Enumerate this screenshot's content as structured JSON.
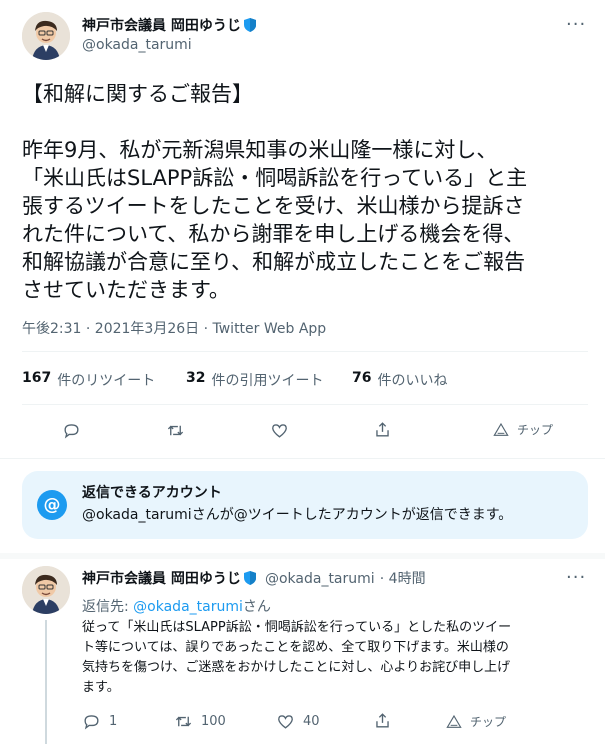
{
  "main_tweet": {
    "author_name": "神戸市会議員 岡田ゆうじ",
    "handle": "@okada_tarumi",
    "more_icon": "more-icon",
    "heading": "【和解に関するご報告】",
    "body": "昨年9月、私が元新潟県知事の米山隆一様に対し、\n「米山氏はSLAPP訴訟・恫喝訴訟を行っている」と主\n張するツイートをしたことを受け、米山様から提訴さ\nれた件について、私から謝罪を申し上げる機会を得、\n和解協議が合意に至り、和解が成立したことをご報告\nさせていただきます。",
    "timestamp": "午後2:31 · 2021年3月26日 · Twitter Web App",
    "stats": {
      "retweets": "167",
      "retweets_label": "件のリツイート",
      "quotes": "32",
      "quotes_label": "件の引用ツイート",
      "likes": "76",
      "likes_label": "件のいいね"
    },
    "actions": {
      "tip_label": "チップ"
    }
  },
  "reply_notice": {
    "title": "返信できるアカウント",
    "handle": "@okada_tarumi",
    "desc": "さんが@ツイートしたアカウントが返信できます。"
  },
  "reply_tweet": {
    "author_name": "神戸市会議員 岡田ゆうじ",
    "handle": "@okada_tarumi",
    "time": "· 4時間",
    "reply_to_prefix": "返信先: ",
    "reply_to_handle": "@okada_tarumi",
    "reply_to_suffix": "さん",
    "body": "従って「米山氏はSLAPP訴訟・恫喝訴訟を行っている」とした私のツイー\nト等については、誤りであったことを認め、全て取り下げます。米山様の\n気持ちを傷つけ、ご迷惑をおかけしたことに対し、心よりお詫び申し上げ\nます。",
    "actions": {
      "replies": "1",
      "retweets": "100",
      "likes": "40",
      "tip_label": "チップ"
    }
  },
  "colors": {
    "accent": "#1d9bf0",
    "shield": "#1d9bf0",
    "muted": "#536471"
  }
}
